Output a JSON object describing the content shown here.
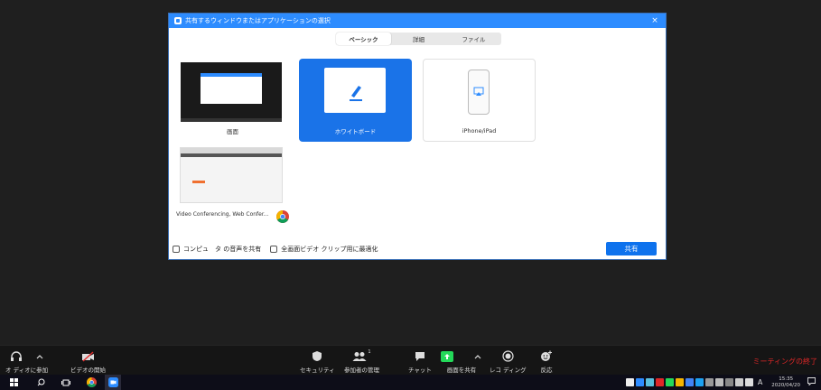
{
  "dialog": {
    "title": "共有するウィンドウまたはアプリケーションの選択",
    "close": "×",
    "tabs": [
      {
        "label": "ベーシック",
        "active": true
      },
      {
        "label": "詳細",
        "active": false
      },
      {
        "label": "ファイル",
        "active": false
      }
    ],
    "tiles": {
      "screen": "画面",
      "whiteboard": "ホワイトボード",
      "iphone": "iPhone/iPad",
      "browser": "Video Conferencing, Web Confer..."
    },
    "footer": {
      "share_audio": "コンピュ　タ の音声を共有",
      "optimize_video": "全画面ビデオ クリップ用に最適化",
      "share_button": "共有"
    }
  },
  "toolbar": {
    "join_audio": "オ ディオに参加",
    "start_video": "ビデオの開始",
    "security": "セキュリティ",
    "participants": "参加者の管理",
    "participants_count": "1",
    "chat": "チャット",
    "share_screen": "画面を共有",
    "record": "レコ ディング",
    "reactions": "反応",
    "end_meeting": "ミーティングの終了"
  },
  "taskbar": {
    "ime": "A",
    "time": "15:35",
    "date": "2020/04/20"
  },
  "colors": {
    "zoom_blue": "#2d8cff",
    "share_green": "#23d959",
    "end_red": "#e02828"
  }
}
